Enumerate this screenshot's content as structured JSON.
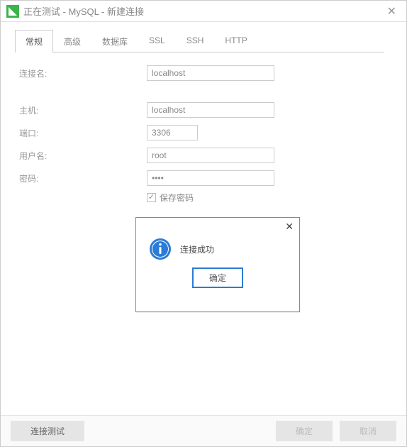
{
  "window": {
    "title": "正在测试 - MySQL - 新建连接"
  },
  "tabs": [
    "常规",
    "高级",
    "数据库",
    "SSL",
    "SSH",
    "HTTP"
  ],
  "active_tab": 0,
  "form": {
    "conn_name_label": "连接名:",
    "conn_name_value": "localhost",
    "host_label": "主机:",
    "host_value": "localhost",
    "port_label": "端口:",
    "port_value": "3306",
    "user_label": "用户名:",
    "user_value": "root",
    "password_label": "密码:",
    "password_value": "••••",
    "save_password_label": "保存密码",
    "save_password_checked": true
  },
  "modal": {
    "message": "连接成功",
    "ok_label": "确定"
  },
  "footer": {
    "test_label": "连接测试",
    "ok_label": "确定",
    "cancel_label": "取消"
  }
}
